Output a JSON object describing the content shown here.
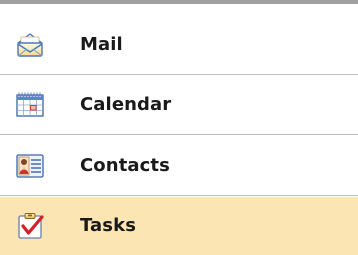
{
  "nav": {
    "items": [
      {
        "label": "Mail",
        "icon": "mail-icon",
        "selected": false
      },
      {
        "label": "Calendar",
        "icon": "calendar-icon",
        "selected": false
      },
      {
        "label": "Contacts",
        "icon": "contacts-icon",
        "selected": false
      },
      {
        "label": "Tasks",
        "icon": "tasks-icon",
        "selected": true
      }
    ]
  },
  "colors": {
    "selected_background": "#fbe5b3",
    "divider": "#bdbdbd",
    "top_border": "#a0a0a0",
    "label_text": "#1a1a1a"
  }
}
